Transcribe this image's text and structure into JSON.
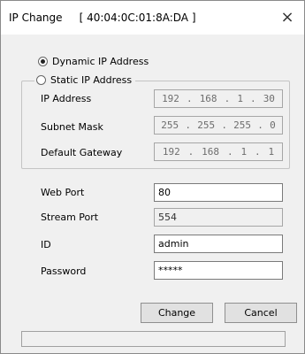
{
  "window": {
    "title": "IP Change     [ 40:04:0C:01:8A:DA ]",
    "close_glyph": "×"
  },
  "network_mode": {
    "dynamic_label": "Dynamic IP Address",
    "static_label": "Static IP Address",
    "selected": "dynamic"
  },
  "static_ip": {
    "ip_label": "IP Address",
    "ip_octets": [
      "192",
      "168",
      "1",
      "30"
    ],
    "subnet_label": "Subnet Mask",
    "subnet_octets": [
      "255",
      "255",
      "255",
      "0"
    ],
    "gateway_label": "Default Gateway",
    "gateway_octets": [
      "192",
      "168",
      "1",
      "1"
    ]
  },
  "ports": {
    "web_port_label": "Web Port",
    "web_port_value": "80",
    "stream_port_label": "Stream Port",
    "stream_port_value": "554"
  },
  "credentials": {
    "id_label": "ID",
    "id_value": "admin",
    "password_label": "Password",
    "password_value": "*****"
  },
  "buttons": {
    "change_label": "Change",
    "cancel_label": "Cancel"
  },
  "status": {
    "text": ""
  }
}
